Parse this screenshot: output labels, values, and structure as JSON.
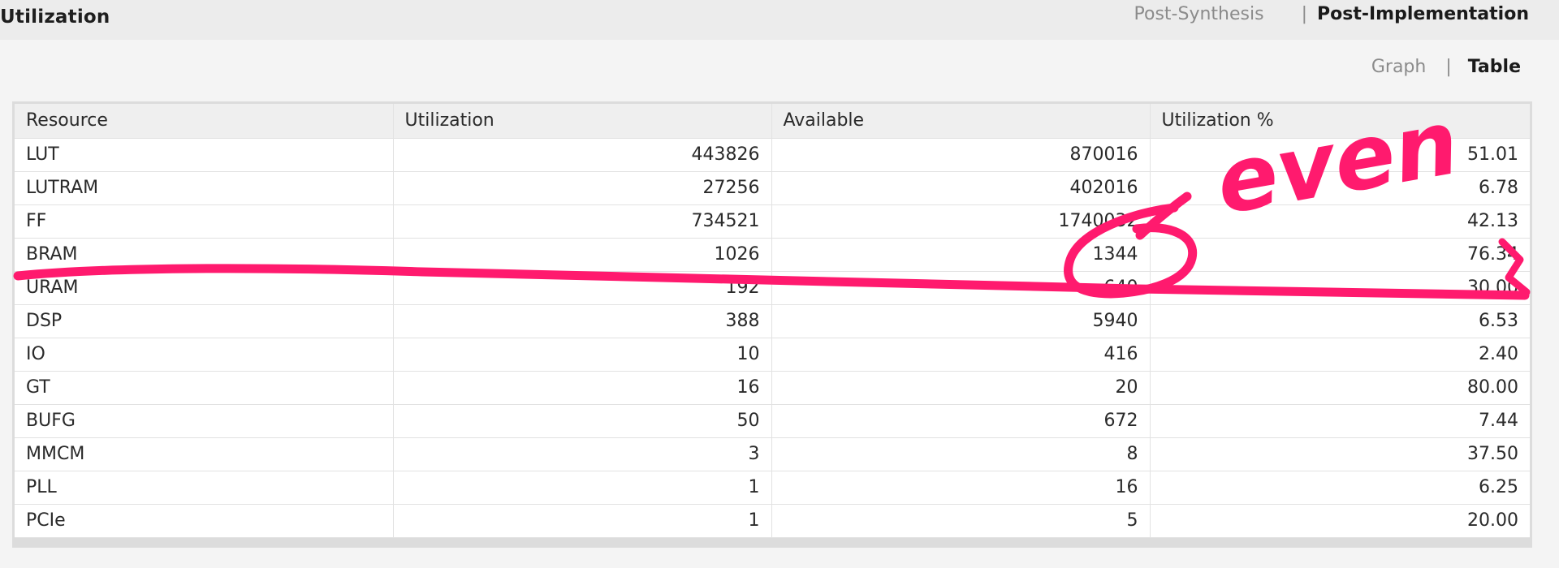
{
  "header": {
    "title": "Utilization",
    "phase_options": [
      "Post-Synthesis",
      "Post-Implementation"
    ],
    "phase_active": "Post-Implementation",
    "separator": "|"
  },
  "view": {
    "options": [
      "Graph",
      "Table"
    ],
    "active": "Table",
    "separator": "|"
  },
  "table": {
    "columns": [
      "Resource",
      "Utilization",
      "Available",
      "Utilization %"
    ],
    "rows": [
      [
        "LUT",
        "443826",
        "870016",
        "51.01"
      ],
      [
        "LUTRAM",
        "27256",
        "402016",
        "6.78"
      ],
      [
        "FF",
        "734521",
        "1740032",
        "42.13"
      ],
      [
        "BRAM",
        "1026",
        "1344",
        "76.34"
      ],
      [
        "URAM",
        "192",
        "640",
        "30.00"
      ],
      [
        "DSP",
        "388",
        "5940",
        "6.53"
      ],
      [
        "IO",
        "10",
        "416",
        "2.40"
      ],
      [
        "GT",
        "16",
        "20",
        "80.00"
      ],
      [
        "BUFG",
        "50",
        "672",
        "7.44"
      ],
      [
        "MMCM",
        "3",
        "8",
        "37.50"
      ],
      [
        "PLL",
        "1",
        "16",
        "6.25"
      ],
      [
        "PCIe",
        "1",
        "5",
        "20.00"
      ]
    ]
  },
  "annotation": {
    "text": "even",
    "color": "#ff1a6e"
  }
}
